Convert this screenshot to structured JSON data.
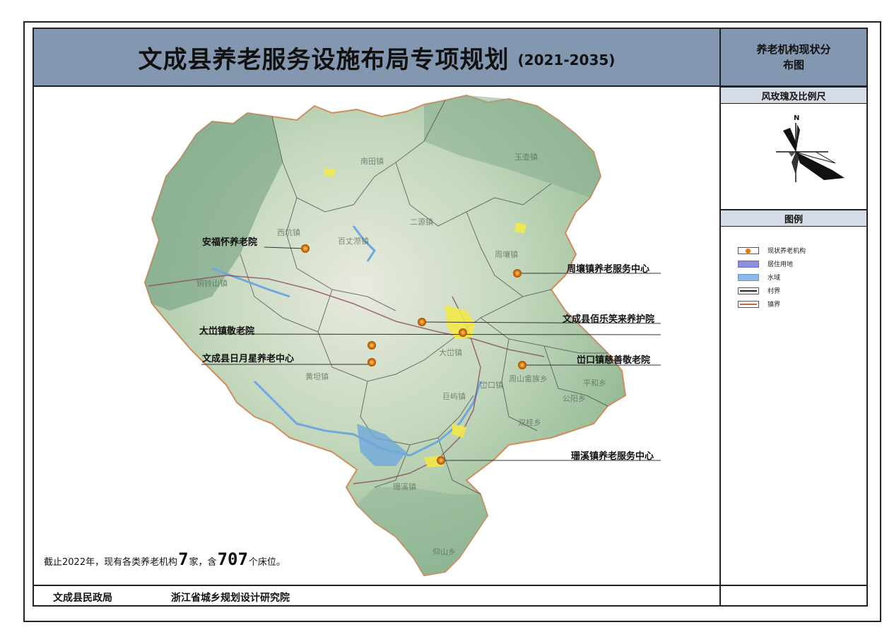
{
  "title": {
    "main": "文成县养老服务设施布局专项规划",
    "years": "(2021-2035)"
  },
  "side_panel": {
    "title_line1": "养老机构现状分",
    "title_line2": "布图",
    "compass_header": "风玫瑰及比例尺",
    "compass_north": "N",
    "legend_header": "图例"
  },
  "legend": [
    {
      "label": "现状养老机构",
      "swatch": "facility",
      "color": "#e07b12"
    },
    {
      "label": "居住用地",
      "swatch": "fill",
      "color": "#8f8fe0"
    },
    {
      "label": "水域",
      "swatch": "fill",
      "color": "#8fb8ea"
    },
    {
      "label": "村界",
      "swatch": "line",
      "color": "#222222"
    },
    {
      "label": "镇界",
      "swatch": "line",
      "color": "#c4683a"
    }
  ],
  "facilities": [
    {
      "name": "安福怀养老院"
    },
    {
      "name": "周壤镇养老服务中心"
    },
    {
      "name": "文成县佰乐笑来养护院"
    },
    {
      "name": "大峃镇敬老院"
    },
    {
      "name": "文成县日月星养老中心"
    },
    {
      "name": "峃口镇慈善敬老院"
    },
    {
      "name": "珊溪镇养老服务中心"
    }
  ],
  "town_labels": [
    "南田镇",
    "玉壶镇",
    "西坑镇",
    "百丈漈镇",
    "二源镇",
    "周壤镇",
    "大峃镇",
    "黄坦镇",
    "峃口镇",
    "巨屿镇",
    "周山畲族乡",
    "平和乡",
    "公阳乡",
    "双桂乡",
    "珊溪镇",
    "铜铃山镇",
    "仰山乡"
  ],
  "note": {
    "prefix": "截止2022年，现有各类养老机构",
    "count": "7",
    "middle": "家，含",
    "beds": "707",
    "suffix": "个床位。"
  },
  "footer": {
    "left": "文成县民政局",
    "right": "浙江省城乡规划设计研究院"
  },
  "colors": {
    "header_band": "#8497b0",
    "side_header": "#d6dce5",
    "terrain": "#9cbf9c",
    "boundary": "#c4683a",
    "water": "#6fa8dc",
    "facility": "#e07b12"
  }
}
